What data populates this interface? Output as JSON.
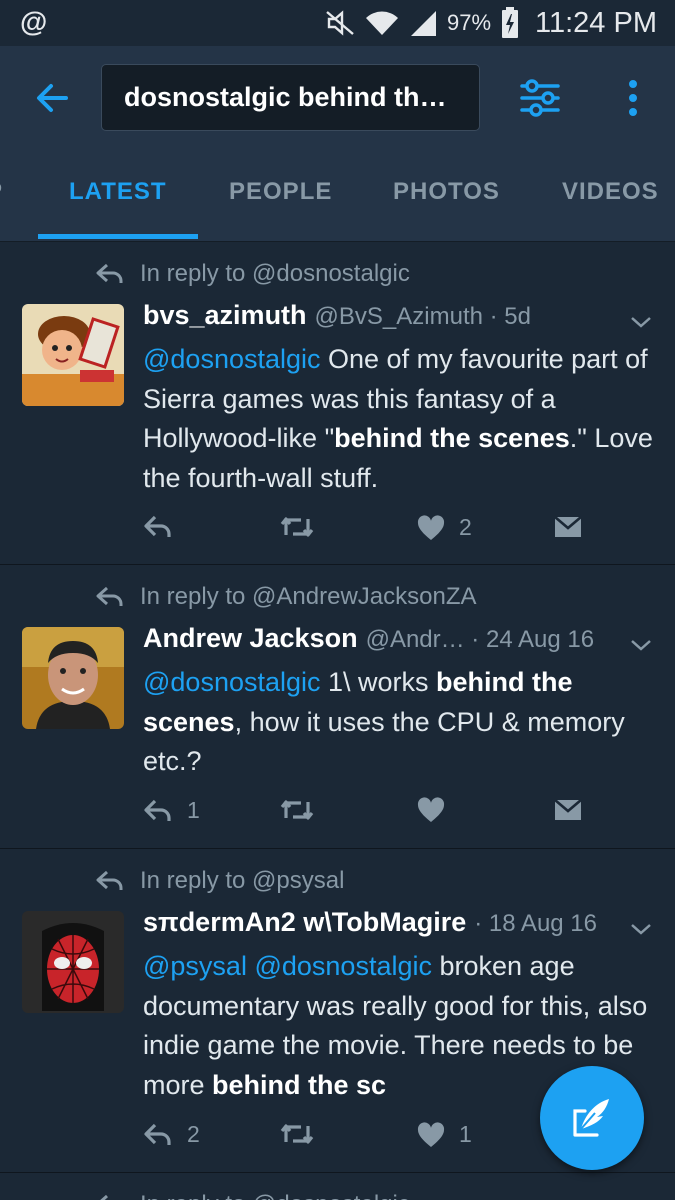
{
  "status_bar": {
    "left_icon": "@",
    "battery_percent": "97%",
    "time": "11:24 PM",
    "icons": [
      "mute-icon",
      "wifi-icon",
      "signal-icon",
      "battery-charging-icon"
    ]
  },
  "search": {
    "query": "dosnostalgic behind th…"
  },
  "tabs": [
    {
      "label": "LATEST",
      "active": true
    },
    {
      "label": "PEOPLE",
      "active": false
    },
    {
      "label": "PHOTOS",
      "active": false
    },
    {
      "label": "VIDEOS",
      "active": false
    }
  ],
  "tweets": [
    {
      "reply_context": "In reply to @dosnostalgic",
      "name": "bvs_azimuth",
      "handle": "@BvS_Azimuth · 5d",
      "body": [
        {
          "t": "@dosnostalgic",
          "k": "mention"
        },
        {
          "t": " One of my favourite part of Sierra games was this fantasy of a Hollywood-like \"",
          "k": "text"
        },
        {
          "t": "behind the scenes",
          "k": "highlight"
        },
        {
          "t": ".\" Love the fourth-wall stuff.",
          "k": "text"
        }
      ],
      "reply_count": "",
      "like_count": "2"
    },
    {
      "reply_context": "In reply to @AndrewJacksonZA",
      "name": "Andrew Jackson",
      "handle": "@Andr…  · 24 Aug 16",
      "body": [
        {
          "t": "@dosnostalgic",
          "k": "mention"
        },
        {
          "t": " 1\\ works ",
          "k": "text"
        },
        {
          "t": "behind the scenes",
          "k": "highlight"
        },
        {
          "t": ", how it uses the CPU & memory etc.?",
          "k": "text"
        }
      ],
      "reply_count": "1",
      "like_count": ""
    },
    {
      "reply_context": "In reply to @psysal",
      "name": "sπdermAn2 w\\TobMagire",
      "handle": "· 18 Aug 16",
      "body": [
        {
          "t": "@psysal",
          "k": "mention"
        },
        {
          "t": " ",
          "k": "text"
        },
        {
          "t": "@dosnostalgic",
          "k": "mention"
        },
        {
          "t": " broken age documentary was really good for this, also indie game the movie. There needs to be more ",
          "k": "text"
        },
        {
          "t": "behind the sc",
          "k": "highlight"
        }
      ],
      "reply_count": "2",
      "like_count": "1"
    },
    {
      "reply_context": "In reply to @dosnostalgic"
    }
  ],
  "colors": {
    "background": "#1b2836",
    "toolbar": "#243447",
    "accent": "#1da1f2",
    "muted": "#8899a6"
  },
  "icons": {
    "back": "arrow-left-icon",
    "filter": "sliders-icon",
    "more": "vertical-dots-icon",
    "reply": "reply-icon",
    "retweet": "retweet-icon",
    "like": "heart-icon",
    "dm": "envelope-icon",
    "compose": "feather-compose-icon"
  }
}
